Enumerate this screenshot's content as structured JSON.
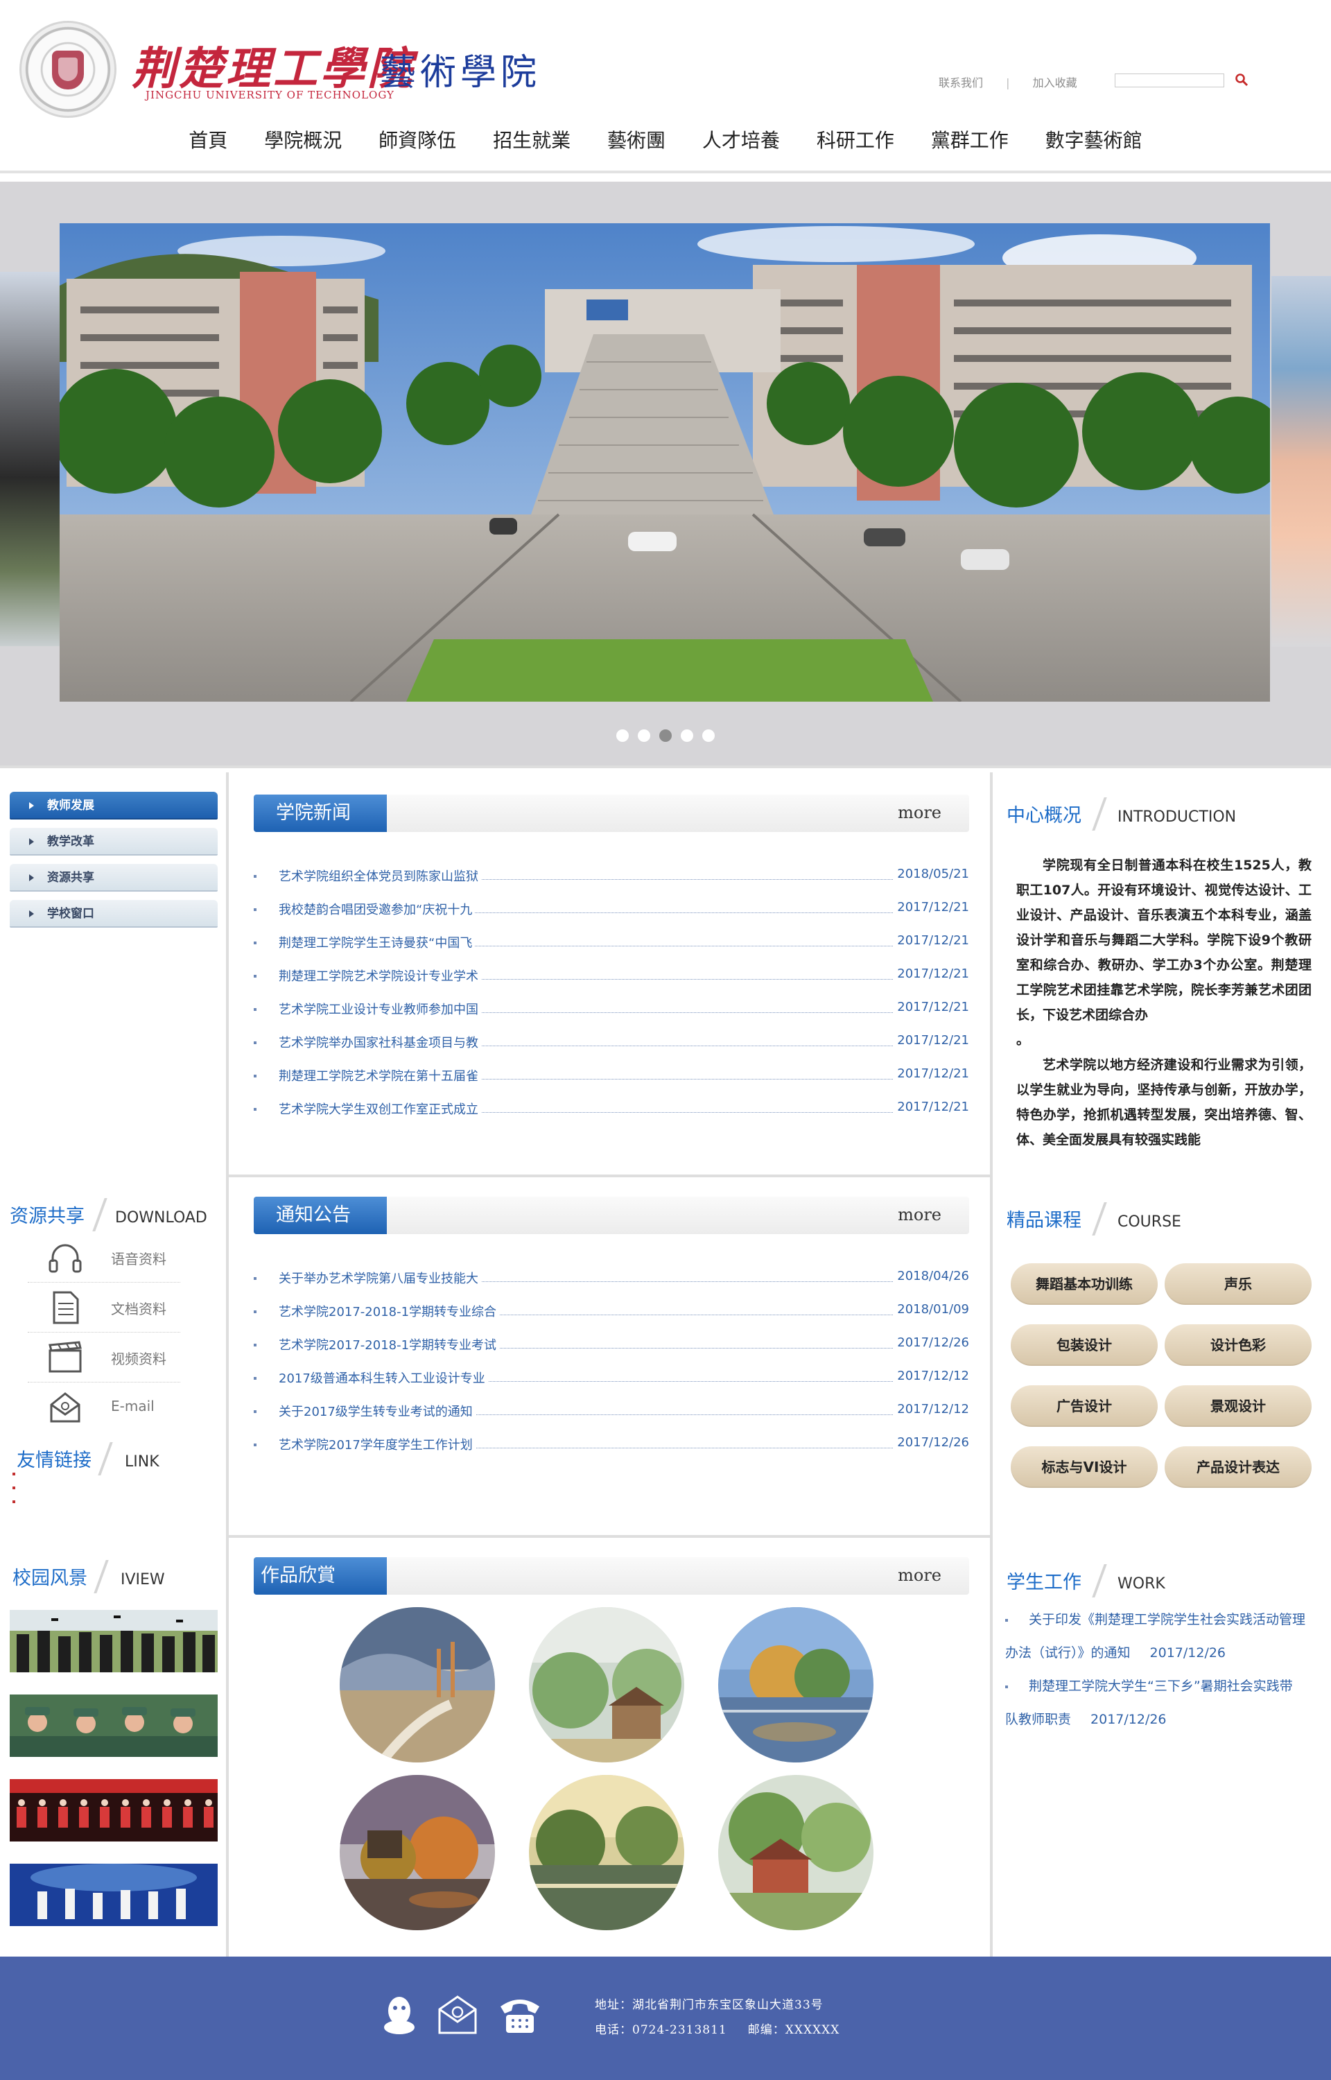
{
  "header": {
    "logo_cn": "荆楚理工學院",
    "logo_en": "JINGCHU UNIVERSITY OF TECHNOLOGY",
    "logo_art": "藝術學院",
    "top_links": [
      "联系我们",
      "加入收藏"
    ],
    "search_placeholder": ""
  },
  "nav": {
    "items": [
      "首頁",
      "學院概況",
      "師資隊伍",
      "招生就業",
      "藝術團",
      "人才培養",
      "科研工作",
      "黨群工作",
      "數字藝術館"
    ]
  },
  "banner": {
    "dots": 5,
    "active_dot": 2
  },
  "left": {
    "menu": [
      "教师发展",
      "教学改革",
      "资源共享",
      "学校窗口"
    ],
    "download_head": {
      "cn": "资源共享",
      "en": "DOWNLOAD"
    },
    "downloads": [
      {
        "label": "语音资料",
        "icon": "headphones-icon"
      },
      {
        "label": "文档资料",
        "icon": "document-icon"
      },
      {
        "label": "视频资料",
        "icon": "video-icon"
      },
      {
        "label": "E-mail",
        "icon": "email-icon"
      }
    ],
    "link_head": {
      "cn": "友情链接",
      "en": "LINK"
    },
    "iview_head": {
      "cn": "校园风景",
      "en": "IVIEW"
    }
  },
  "middle": {
    "news": {
      "title": "学院新闻",
      "more": "more",
      "items": [
        {
          "title": "艺术学院组织全体党员到陈家山监狱",
          "date": "2018/05/21"
        },
        {
          "title": "我校楚韵合唱团受邀参加“庆祝十九",
          "date": "2017/12/21"
        },
        {
          "title": "荆楚理工学院学生王诗曼获“中国飞",
          "date": "2017/12/21"
        },
        {
          "title": "荆楚理工学院艺术学院设计专业学术",
          "date": "2017/12/21"
        },
        {
          "title": "艺术学院工业设计专业教师参加中国",
          "date": "2017/12/21"
        },
        {
          "title": "艺术学院举办国家社科基金项目与教",
          "date": "2017/12/21"
        },
        {
          "title": "荆楚理工学院艺术学院在第十五届雀",
          "date": "2017/12/21"
        },
        {
          "title": "艺术学院大学生双创工作室正式成立",
          "date": "2017/12/21"
        }
      ]
    },
    "notice": {
      "title": "通知公告",
      "more": "more",
      "items": [
        {
          "title": "关于举办艺术学院第八届专业技能大",
          "date": "2018/04/26"
        },
        {
          "title": "艺术学院2017-2018-1学期转专业综合",
          "date": "2018/01/09"
        },
        {
          "title": "艺术学院2017-2018-1学期转专业考试",
          "date": "2017/12/26"
        },
        {
          "title": "2017级普通本科生转入工业设计专业",
          "date": "2017/12/12"
        },
        {
          "title": "关于2017级学生转专业考试的通知",
          "date": "2017/12/12"
        },
        {
          "title": "艺术学院2017学年度学生工作计划",
          "date": "2017/12/26"
        }
      ]
    },
    "works": {
      "title": "作品欣賞",
      "more": "more"
    }
  },
  "right": {
    "intro_head": {
      "cn": "中心概况",
      "en": "INTRODUCTION"
    },
    "intro_p1": "学院现有全日制普通本科在校生1525人，教职工107人。开设有环境设计、视觉传达设计、工业设计、产品设计、音乐表演五个本科专业，涵盖设计学和音乐与舞蹈二大学科。学院下设9个教研室和综合办、教研办、学工办3个办公室。荆楚理工学院艺术团挂靠艺术学院，院长李芳兼艺术团团长，下设艺术团综合办",
    "intro_p1_end": "。",
    "intro_p2": "艺术学院以地方经济建设和行业需求为引领，以学生就业为导向，坚持传承与创新，开放办学，特色办学，抢抓机遇转型发展，突出培养德、智、体、美全面发展具有较强实践能",
    "course_head": {
      "cn": "精品课程",
      "en": "COURSE"
    },
    "courses": [
      "舞蹈基本功训练",
      "声乐",
      "包装设计",
      "设计色彩",
      "广告设计",
      "景观设计",
      "标志与VI设计",
      "产品设计表达"
    ],
    "work_head": {
      "cn": "学生工作",
      "en": "WORK"
    },
    "work_items": [
      {
        "title1": "关于印发《荆楚理工学院学生社会实践活动管理",
        "title2": "办法（试行）》的通知",
        "date": "2017/12/26"
      },
      {
        "title1": "荆楚理工学院大学生“三下乡”暑期社会实践带",
        "title2": "队教师职责",
        "date": "2017/12/26"
      }
    ]
  },
  "footer": {
    "address": "地址：湖北省荆门市东宝区象山大道33号",
    "phone": "电话：0724-2313811",
    "postcode": "邮编：XXXXXX"
  },
  "colors": {
    "accent_blue": "#1d6cc8",
    "footer_blue": "#4b63aa",
    "logo_red": "#c4263d"
  }
}
